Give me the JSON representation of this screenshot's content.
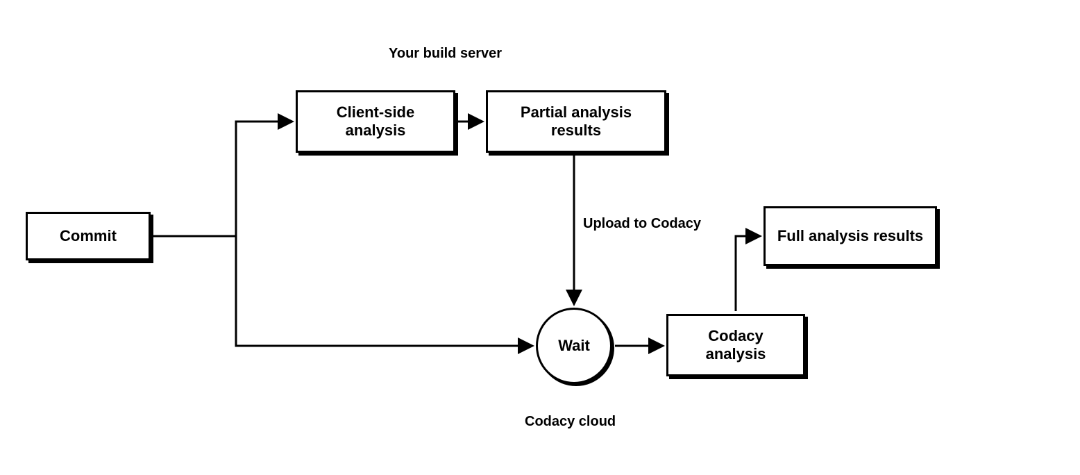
{
  "groups": {
    "top": "Your build server",
    "bottom": "Codacy cloud"
  },
  "nodes": {
    "commit": "Commit",
    "client_side_analysis": "Client-side analysis",
    "partial_results": "Partial analysis results",
    "wait": "Wait",
    "codacy_analysis": "Codacy analysis",
    "full_results": "Full analysis results"
  },
  "edges": {
    "upload": "Upload to Codacy"
  }
}
